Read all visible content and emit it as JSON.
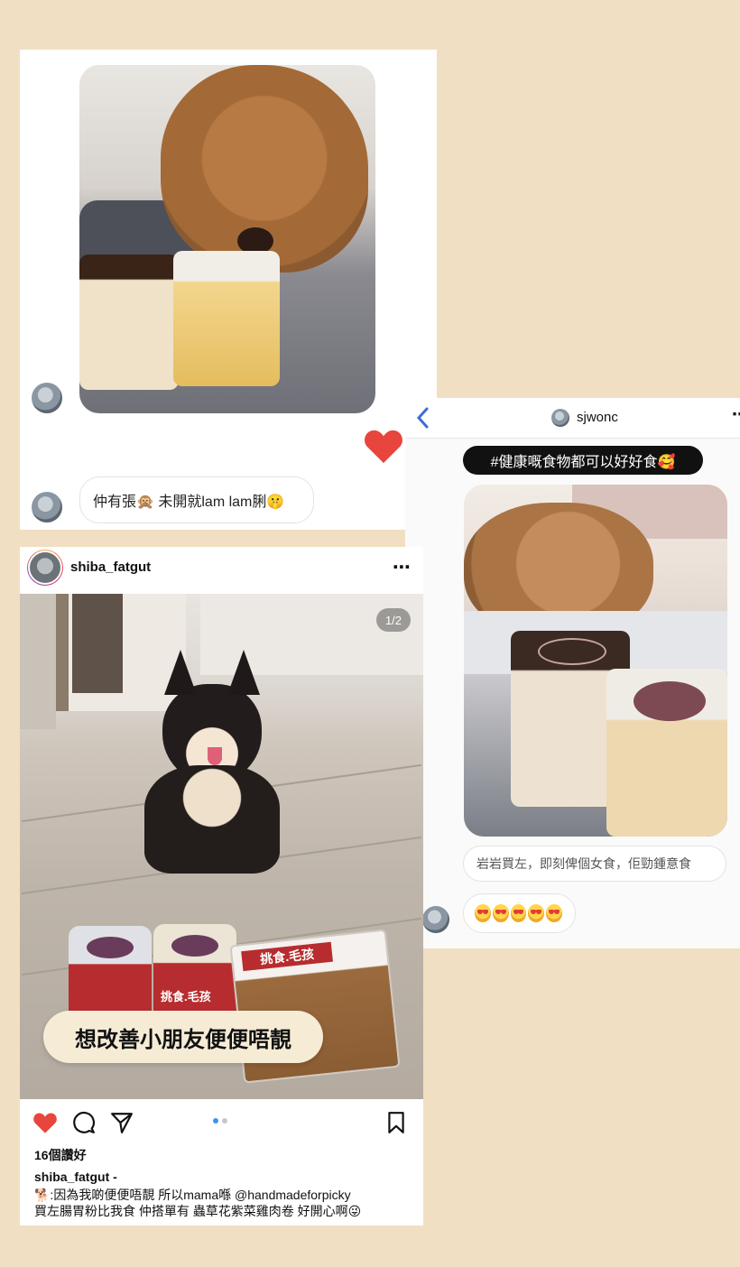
{
  "dm_top": {
    "reply_message": "仲有張🙊 未開就lam lam脷🤫"
  },
  "dm_right": {
    "back_icon": "chevron-left-icon",
    "username": "sjwonc",
    "more_icon": "ellipsis-icon",
    "caption_banner": "#健康嘅食物都可以好好食🥰",
    "message_1": "岩岩買左，即刻俾個女食，佢勁鍾意食",
    "message_2_emoji_count": 5
  },
  "post": {
    "username": "shiba_fatgut",
    "more_icon": "ellipsis-icon",
    "page_indicator": "1/2",
    "overlay_sticker": "想改善小朋友便便唔靚",
    "bag_label": "挑食.毛孩",
    "jar_label": "挑食.毛孩",
    "likes": "16個讚好",
    "caption_username": "shiba_fatgut -",
    "caption_line_1": "🐕:因為我啲便便唔靚 所以mama喺 @handmadeforpicky",
    "caption_line_2": "買左腸胃粉比我食 仲搭單有 蟲草花紫菜雞肉卷 好開心啊😜",
    "carousel_total": 2,
    "carousel_current": 1
  },
  "colors": {
    "background": "#f1dfc3",
    "like_red": "#e8453c",
    "ig_blue": "#3897f0"
  }
}
